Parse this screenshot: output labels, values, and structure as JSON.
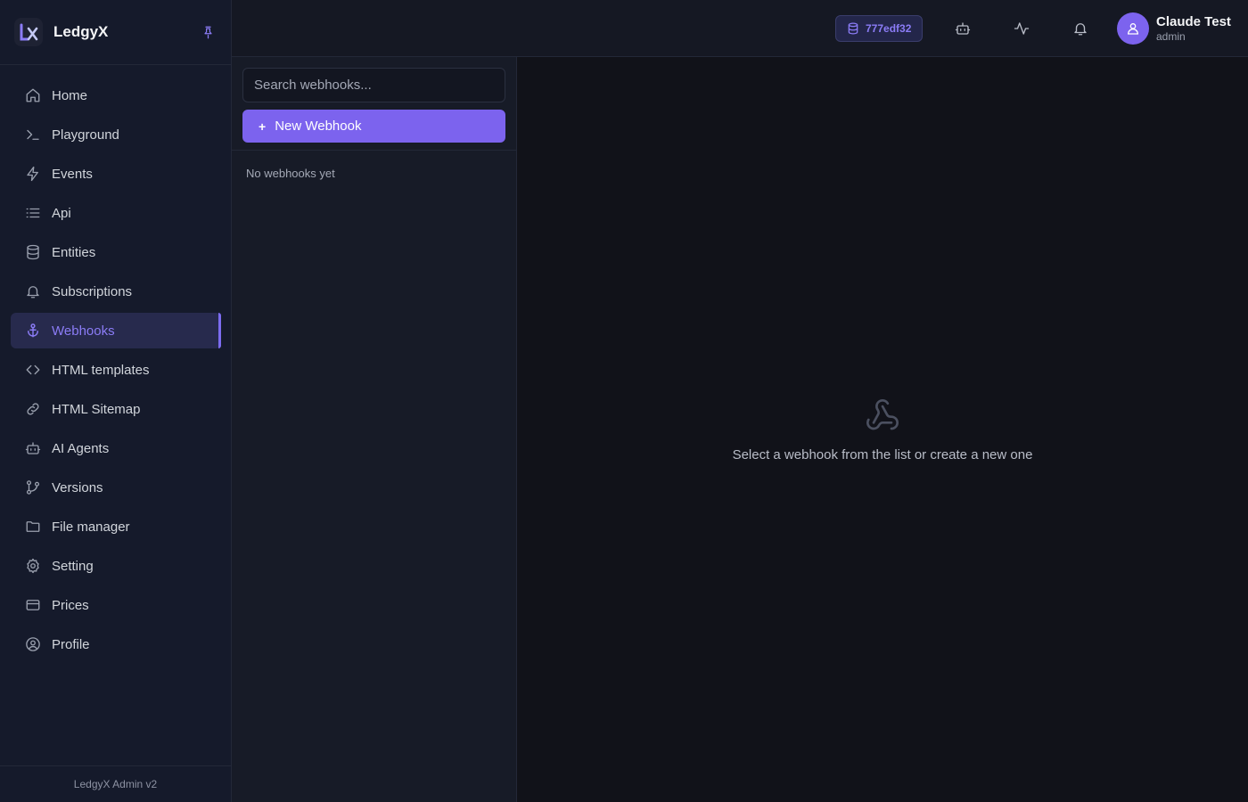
{
  "brand": {
    "name": "LedgyX"
  },
  "sidebar": {
    "items": [
      {
        "label": "Home",
        "icon": "home-icon"
      },
      {
        "label": "Playground",
        "icon": "terminal-icon"
      },
      {
        "label": "Events",
        "icon": "lightning-icon"
      },
      {
        "label": "Api",
        "icon": "list-icon"
      },
      {
        "label": "Entities",
        "icon": "database-icon"
      },
      {
        "label": "Subscriptions",
        "icon": "bell-icon"
      },
      {
        "label": "Webhooks",
        "icon": "anchor-icon",
        "active": true
      },
      {
        "label": "HTML templates",
        "icon": "code-icon"
      },
      {
        "label": "HTML Sitemap",
        "icon": "link-icon"
      },
      {
        "label": "AI Agents",
        "icon": "bot-icon"
      },
      {
        "label": "Versions",
        "icon": "git-branch-icon"
      },
      {
        "label": "File manager",
        "icon": "folder-icon"
      },
      {
        "label": "Setting",
        "icon": "gear-icon"
      },
      {
        "label": "Prices",
        "icon": "credit-card-icon"
      },
      {
        "label": "Profile",
        "icon": "user-circle-icon"
      }
    ],
    "footer": "LedgyX Admin v2"
  },
  "topbar": {
    "db_id": "777edf32",
    "user": {
      "name": "Claude Test",
      "role": "admin"
    }
  },
  "webhooks": {
    "search_placeholder": "Search webhooks...",
    "new_button": "New Webhook",
    "empty_list": "No webhooks yet"
  },
  "main": {
    "empty_message": "Select a webhook from the list or create a new one"
  },
  "colors": {
    "accent": "#7c63ee",
    "active_text": "#8b7cf6",
    "background": "#111219"
  }
}
